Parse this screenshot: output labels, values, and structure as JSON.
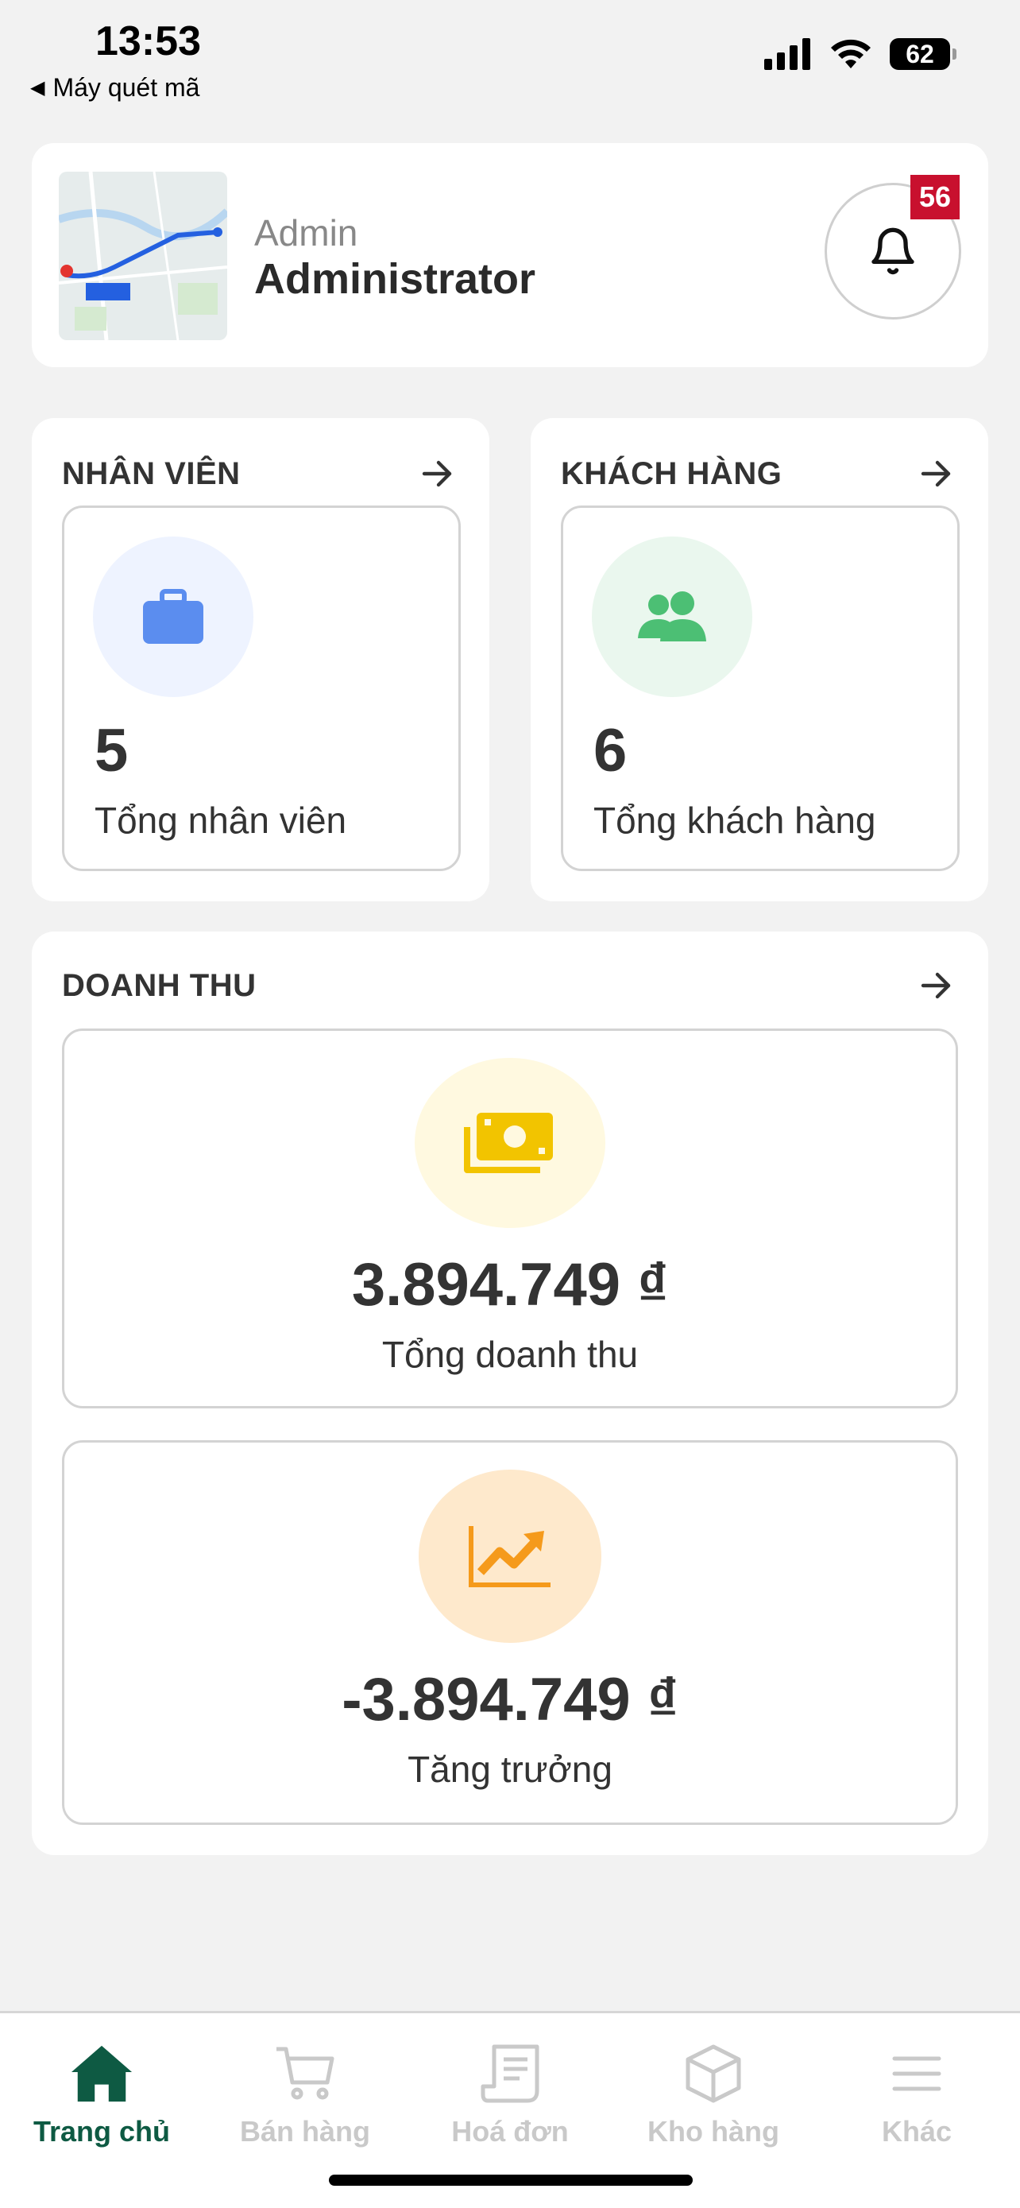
{
  "status_bar": {
    "time": "13:53",
    "back_app": "Máy quét mã",
    "battery": "62"
  },
  "profile": {
    "role": "Admin",
    "name": "Administrator",
    "notification_count": "56"
  },
  "employees": {
    "title": "NHÂN VIÊN",
    "count": "5",
    "label": "Tổng nhân viên",
    "icon": "briefcase-icon",
    "accent": "#5b8def",
    "bg": "#eef3ff"
  },
  "customers": {
    "title": "KHÁCH HÀNG",
    "count": "6",
    "label": "Tổng khách hàng",
    "icon": "users-icon",
    "accent": "#4cbf74",
    "bg": "#eaf7ee"
  },
  "revenue": {
    "title": "DOANH THU",
    "total_value": "3.894.749 ₫",
    "total_label": "Tổng doanh thu",
    "growth_value": "-3.894.749 ₫",
    "growth_label": "Tăng trưởng",
    "total_accent": "#f2c400",
    "growth_accent": "#f59a1b"
  },
  "tabbar": {
    "active_color": "#0e5a43",
    "inactive_color": "#c9c9c9",
    "items": [
      {
        "label": "Trang chủ",
        "icon": "home-icon"
      },
      {
        "label": "Bán hàng",
        "icon": "cart-icon"
      },
      {
        "label": "Hoá đơn",
        "icon": "receipt-icon"
      },
      {
        "label": "Kho hàng",
        "icon": "box-icon"
      },
      {
        "label": "Khác",
        "icon": "menu-icon"
      }
    ]
  }
}
